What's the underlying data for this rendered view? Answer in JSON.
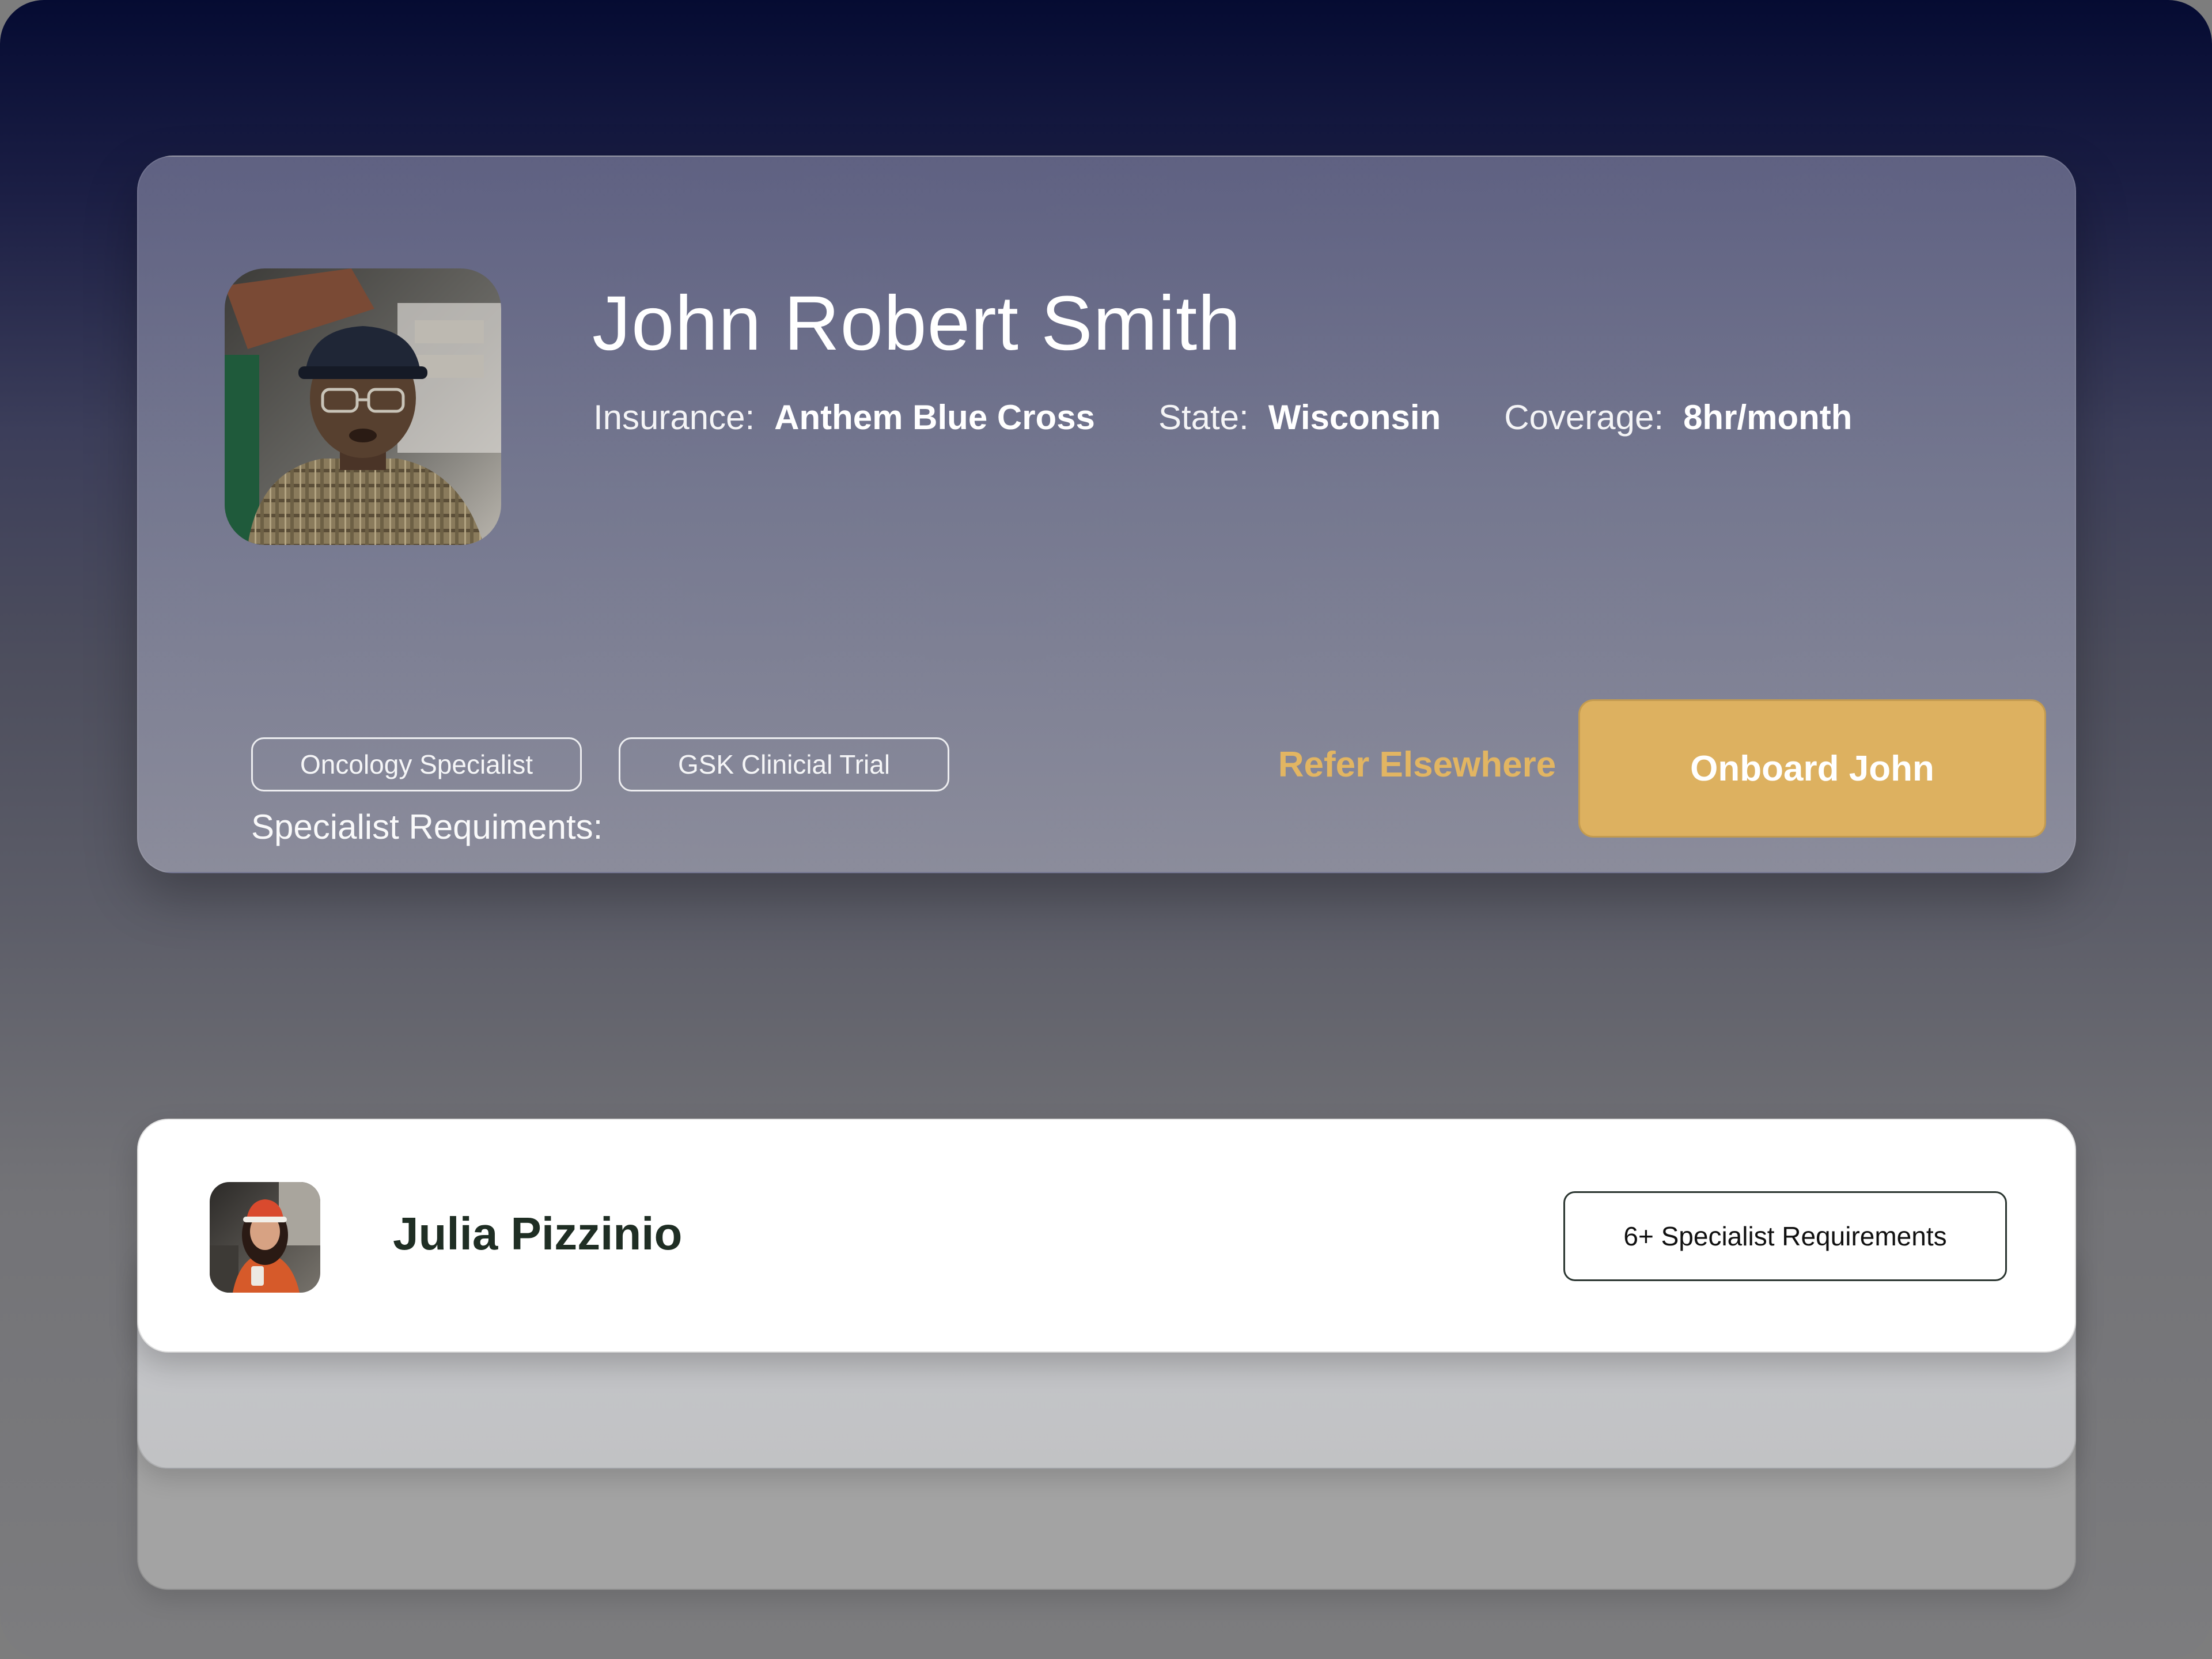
{
  "featured_patient": {
    "name": "John Robert Smith",
    "photo_icon": "person-photo-icon",
    "insurance_label": "Insurance:",
    "insurance_value": "Anthem Blue Cross",
    "state_label": "State:",
    "state_value": "Wisconsin",
    "coverage_label": "Coverage:",
    "coverage_value": "8hr/month",
    "requirements_label": "Specialist Requiments:",
    "requirements": [
      {
        "label": "Oncology Specialist"
      },
      {
        "label": "GSK Clinicial Trial"
      }
    ],
    "refer_label": "Refer Elsewhere",
    "onboard_label": "Onboard John"
  },
  "queue": [
    {
      "name": "Julia Pizzinio",
      "photo_icon": "person-photo-icon",
      "requirements_count_label": "6+ Specialist Requirements"
    }
  ],
  "colors": {
    "accent_gold": "#ddb160",
    "refer_gold": "#e2b562",
    "name_dark_green": "#1f2e24",
    "background_top": "#050b32"
  }
}
